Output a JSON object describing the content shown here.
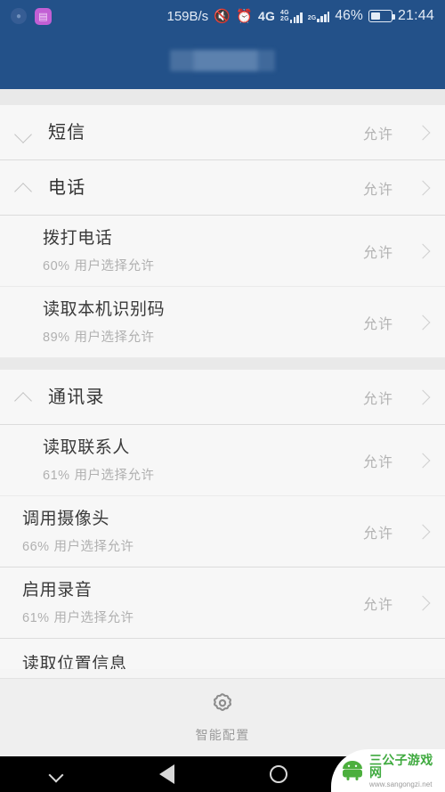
{
  "statusbar": {
    "notifications": [
      "status-notif-circle-icon",
      "status-notif-square-icon"
    ],
    "network_speed": "159B/s",
    "mute_icon": "mute-icon",
    "alarm_icon": "alarm-icon",
    "sim1_label_top": "4G",
    "sim1_label_bottom": "2G",
    "sim1_primary": "4G",
    "sim2_label_top": "2G",
    "battery_percent": "46%",
    "battery_level": 46,
    "clock": "21:44"
  },
  "appbar": {
    "title": "",
    "title_redacted": true
  },
  "list": {
    "state_allow": "允许",
    "sub_suffix": "用户选择允许",
    "rows": [
      {
        "kind": "group",
        "name": "sms",
        "chevron": "chevron-down-icon",
        "title": "短信",
        "state": "允许"
      },
      {
        "kind": "group",
        "name": "phone",
        "chevron": "chevron-up-icon",
        "title": "电话",
        "state": "允许"
      },
      {
        "kind": "sub",
        "name": "make-call",
        "title": "拨打电话",
        "percent": "60%",
        "subtitle": "用户选择允许",
        "state": "允许"
      },
      {
        "kind": "sub",
        "name": "read-device-id",
        "title": "读取本机识别码",
        "percent": "89%",
        "subtitle": "用户选择允许",
        "state": "允许"
      },
      {
        "kind": "group",
        "name": "contacts",
        "chevron": "chevron-up-icon",
        "title": "通讯录",
        "state": "允许"
      },
      {
        "kind": "sub",
        "name": "read-contacts",
        "title": "读取联系人",
        "percent": "61%",
        "subtitle": "用户选择允许",
        "state": "允许"
      },
      {
        "kind": "plain",
        "name": "use-camera",
        "title": "调用摄像头",
        "percent": "66%",
        "subtitle": "用户选择允许",
        "state": "允许"
      },
      {
        "kind": "plain",
        "name": "enable-recording",
        "title": "启用录音",
        "percent": "61%",
        "subtitle": "用户选择允许",
        "state": "允许"
      },
      {
        "kind": "cut",
        "name": "read-location",
        "title": "读取位置信息"
      }
    ]
  },
  "toolbar": {
    "icon": "gear-icon",
    "label": "智能配置"
  },
  "navbar": {
    "hide_label": "hide-navbar-icon",
    "back_label": "back-icon",
    "home_label": "home-icon",
    "recents_label": "recents-icon"
  },
  "watermark": {
    "logo": "android-robot-icon",
    "site_name": "三公子游戏网",
    "site_url": "www.sangongzi.net"
  }
}
